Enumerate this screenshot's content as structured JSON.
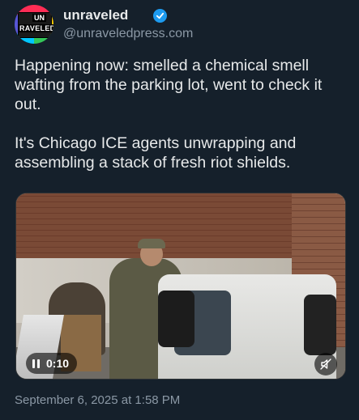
{
  "author": {
    "avatar_text_top": "UN",
    "avatar_text_bottom": "RAVELED",
    "name": "unraveled",
    "handle": "@unraveledpress.com",
    "verified_color": "#1d9bf0"
  },
  "post": {
    "text": "Happening now: smelled a chemical smell wafting from the parking lot, went to check it out.\n\nIt's Chicago ICE agents unwrapping and assembling a stack of fresh riot shields.",
    "timestamp": "September 6, 2025 at 1:58 PM"
  },
  "video": {
    "elapsed": "0:10",
    "state": "playing",
    "controls": {
      "pause_icon": "pause-icon",
      "mute_icon": "muted-speaker-icon"
    }
  },
  "colors": {
    "background": "#15202b",
    "text": "#e7e9ea",
    "secondary_text": "#8b98a5"
  }
}
